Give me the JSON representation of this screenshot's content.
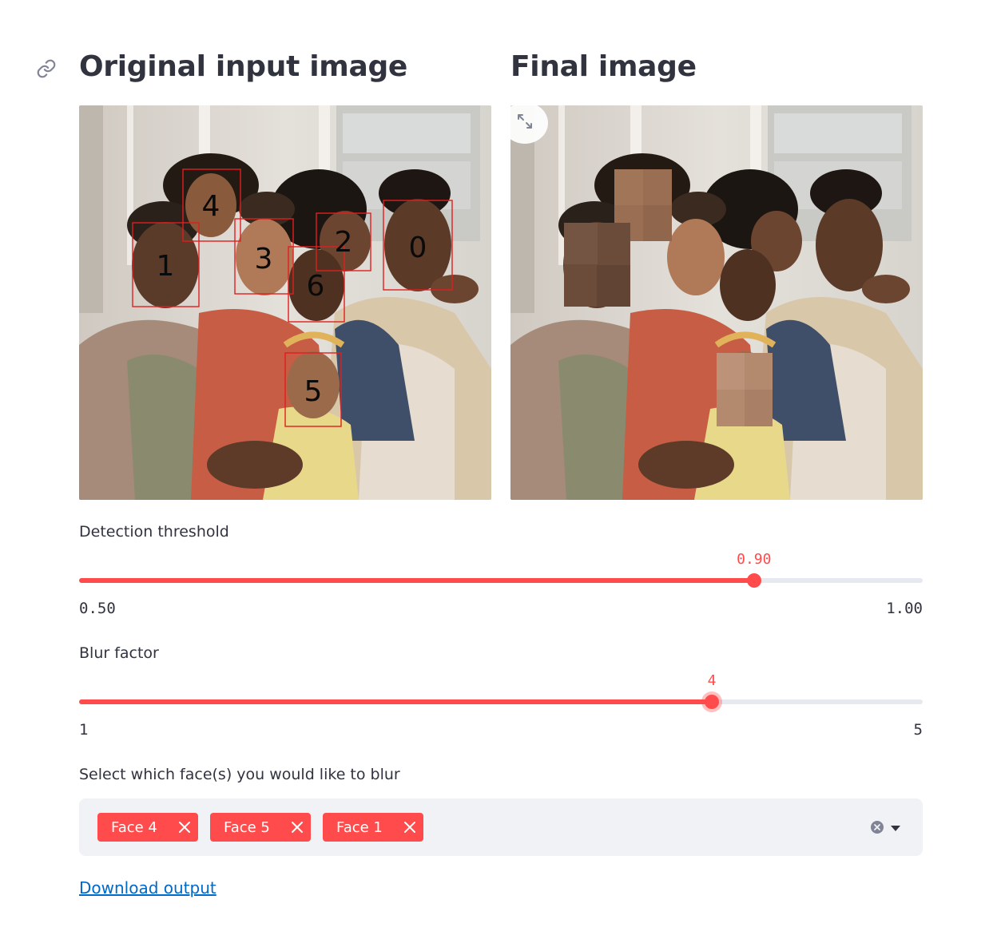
{
  "left_column": {
    "heading": "Original input image"
  },
  "right_column": {
    "heading": "Final image"
  },
  "face_labels": [
    "4",
    "1",
    "3",
    "2",
    "0",
    "6",
    "5"
  ],
  "detection_threshold": {
    "label": "Detection threshold",
    "value": 0.9,
    "value_text": "0.90",
    "min": 0.5,
    "max": 1.0,
    "min_text": "0.50",
    "max_text": "1.00"
  },
  "blur_factor": {
    "label": "Blur factor",
    "value": 4,
    "value_text": "4",
    "min": 1,
    "max": 5,
    "min_text": "1",
    "max_text": "5"
  },
  "face_select": {
    "label": "Select which face(s) you would like to blur",
    "selected": [
      "Face 4",
      "Face 5",
      "Face 1"
    ]
  },
  "download": {
    "label": "Download output"
  },
  "colors": {
    "accent": "#ff4b4b",
    "link": "#0068c9",
    "text": "#31333f",
    "track": "#e6e9ef",
    "select_bg": "#f0f2f6",
    "box": "#e01f1f"
  },
  "icons": [
    "link-icon",
    "fullscreen-icon",
    "close-icon",
    "clear-icon",
    "chevron-down-icon"
  ]
}
